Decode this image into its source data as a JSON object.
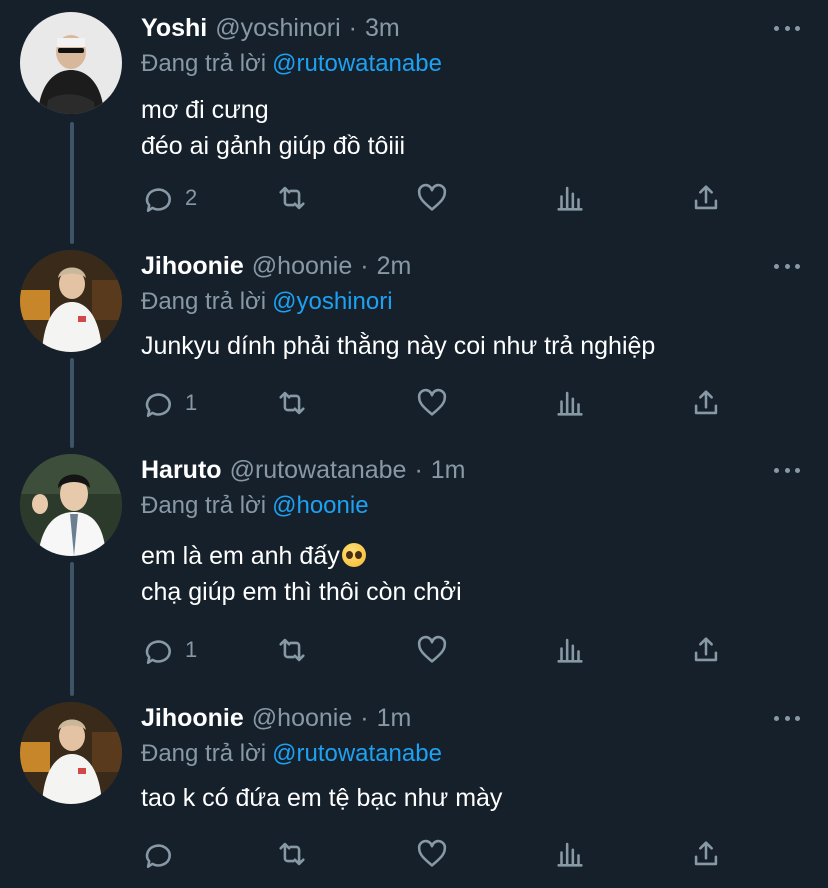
{
  "reply_prefix": "Đang trả lời",
  "colors": {
    "background": "#15202b",
    "muted": "#8899a6",
    "accent": "#1da1f2",
    "line": "#3d5466"
  },
  "tweets": [
    {
      "name": "Yoshi",
      "handle": "@yoshinori",
      "time": "3m",
      "replying_to": "@rutowatanabe",
      "lines": [
        "mơ đi cưng",
        "đéo ai gảnh giúp đồ tôiii"
      ],
      "reply_count": "2"
    },
    {
      "name": "Jihoonie",
      "handle": "@hoonie",
      "time": "2m",
      "replying_to": "@yoshinori",
      "lines": [
        "Junkyu dính phải thằng này coi như trả nghiệp"
      ],
      "reply_count": "1"
    },
    {
      "name": "Haruto",
      "handle": "@rutowatanabe",
      "time": "1m",
      "replying_to": "@hoonie",
      "lines": [
        "em là em anh đấy",
        "chạ giúp em thì thôi còn chởi"
      ],
      "emoji": "pleading-face",
      "reply_count": "1"
    },
    {
      "name": "Jihoonie",
      "handle": "@hoonie",
      "time": "1m",
      "replying_to": "@rutowatanabe",
      "lines": [
        "tao k có đứa em tệ bạc như mày"
      ],
      "reply_count": ""
    }
  ],
  "icons": {
    "reply": "reply-icon",
    "retweet": "retweet-icon",
    "like": "like-icon",
    "analytics": "analytics-icon",
    "share": "share-icon",
    "more": "more-icon"
  }
}
